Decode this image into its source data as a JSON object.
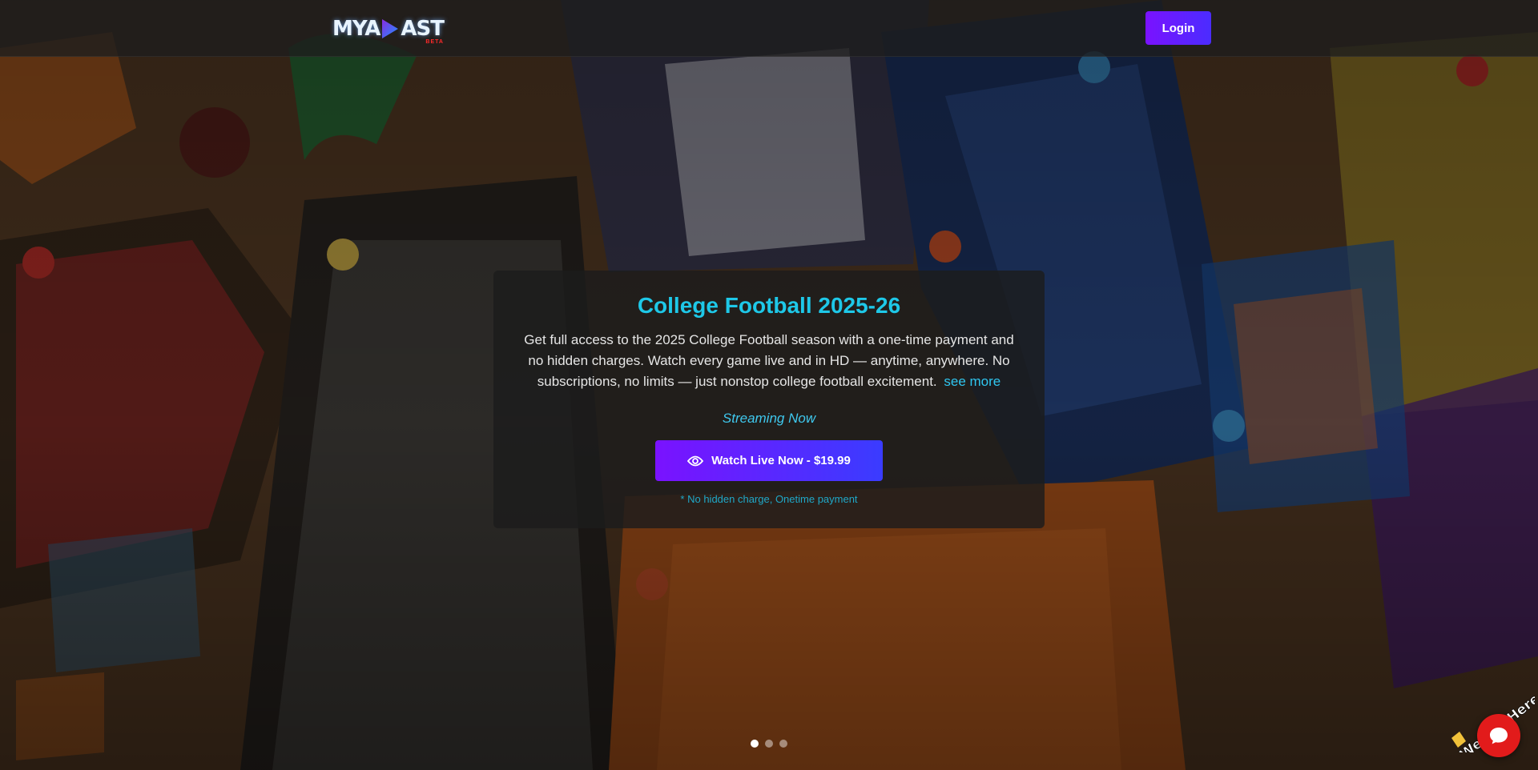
{
  "brand": {
    "logo_text_left": "MYA",
    "logo_text_right": "AST",
    "logo_beta": "BETA"
  },
  "header": {
    "login_label": "Login"
  },
  "hero": {
    "title": "College Football 2025-26",
    "description": "Get full access to the 2025 College Football season with a one-time payment and no hidden charges. Watch every game live and in HD — anytime, anywhere. No subscriptions, no limits — just nonstop college football excitement.",
    "see_more_label": "see more",
    "status": "Streaming Now",
    "watch_button_label": "Watch Live Now - $19.99",
    "watch_icon": "eye-icon",
    "note": "* No hidden charge, Onetime payment"
  },
  "carousel": {
    "slide_count": 3,
    "active_index": 0
  },
  "chat": {
    "banner_text": "We Are Here!",
    "icon": "chat-bubble-icon"
  },
  "colors": {
    "accent_cyan": "#1ec8e8",
    "button_gradient_start": "#7a12ff",
    "button_gradient_end": "#3a3cff",
    "chat_red": "#e21b1b"
  }
}
